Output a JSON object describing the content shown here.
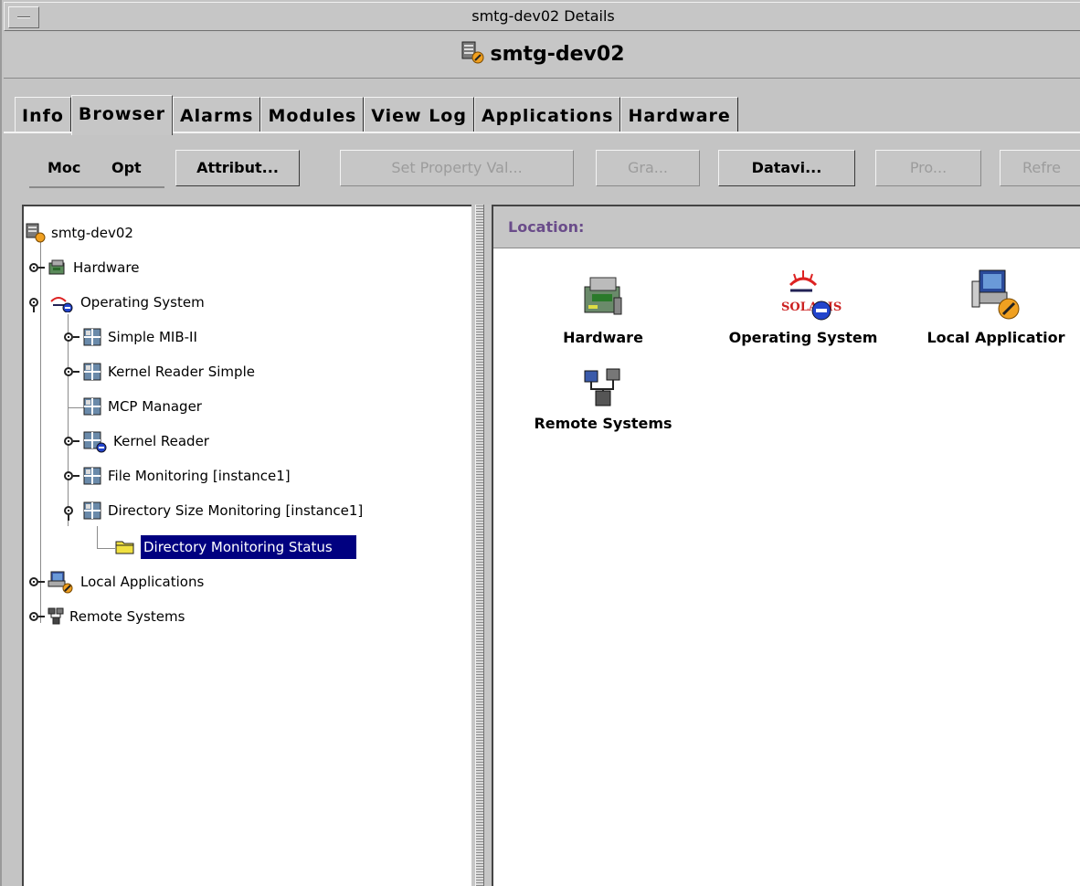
{
  "window": {
    "title": "smtg-dev02 Details",
    "host_name": "smtg-dev02"
  },
  "tabs": [
    {
      "label": "Info",
      "active": false
    },
    {
      "label": "Browser",
      "active": true
    },
    {
      "label": "Alarms",
      "active": false
    },
    {
      "label": "Modules",
      "active": false
    },
    {
      "label": "View Log",
      "active": false
    },
    {
      "label": "Applications",
      "active": false
    },
    {
      "label": "Hardware",
      "active": false
    }
  ],
  "toolbar": {
    "menus": [
      "Mo­",
      "Opt"
    ],
    "menu_mod": "Moc",
    "menu_opt": "Opt",
    "buttons": {
      "attributes": "Attribut...",
      "set_property": "Set Property Val...",
      "graph": "Gra...",
      "dataview": "Datavi...",
      "probe": "Pro...",
      "refresh": "Refre"
    }
  },
  "tree": {
    "root": "smtg-dev02",
    "items": {
      "hardware": "Hardware",
      "operating_system": "Operating System",
      "simple_mib": "Simple MIB-II",
      "kernel_reader_simple": "Kernel Reader Simple",
      "mcp_manager": "MCP Manager",
      "kernel_reader": "Kernel Reader",
      "file_monitoring": "File Monitoring [instance1]",
      "dir_size_monitoring": "Directory Size Monitoring [instance1]",
      "dir_monitoring_status": "Directory Monitoring Status",
      "local_applications": "Local Applications",
      "remote_systems": "Remote Systems"
    },
    "selected": "Directory Monitoring Status"
  },
  "location": {
    "label": "Location:"
  },
  "browser_items": {
    "hardware": "Hardware",
    "operating_system": "Operating System",
    "solaris_logo_text": "SOLARIS",
    "local_applications": "Local Applicatior",
    "remote_systems": "Remote Systems"
  },
  "colors": {
    "chrome": "#c6c6c6",
    "selection": "#000080",
    "location_text": "#6a4c8a"
  }
}
